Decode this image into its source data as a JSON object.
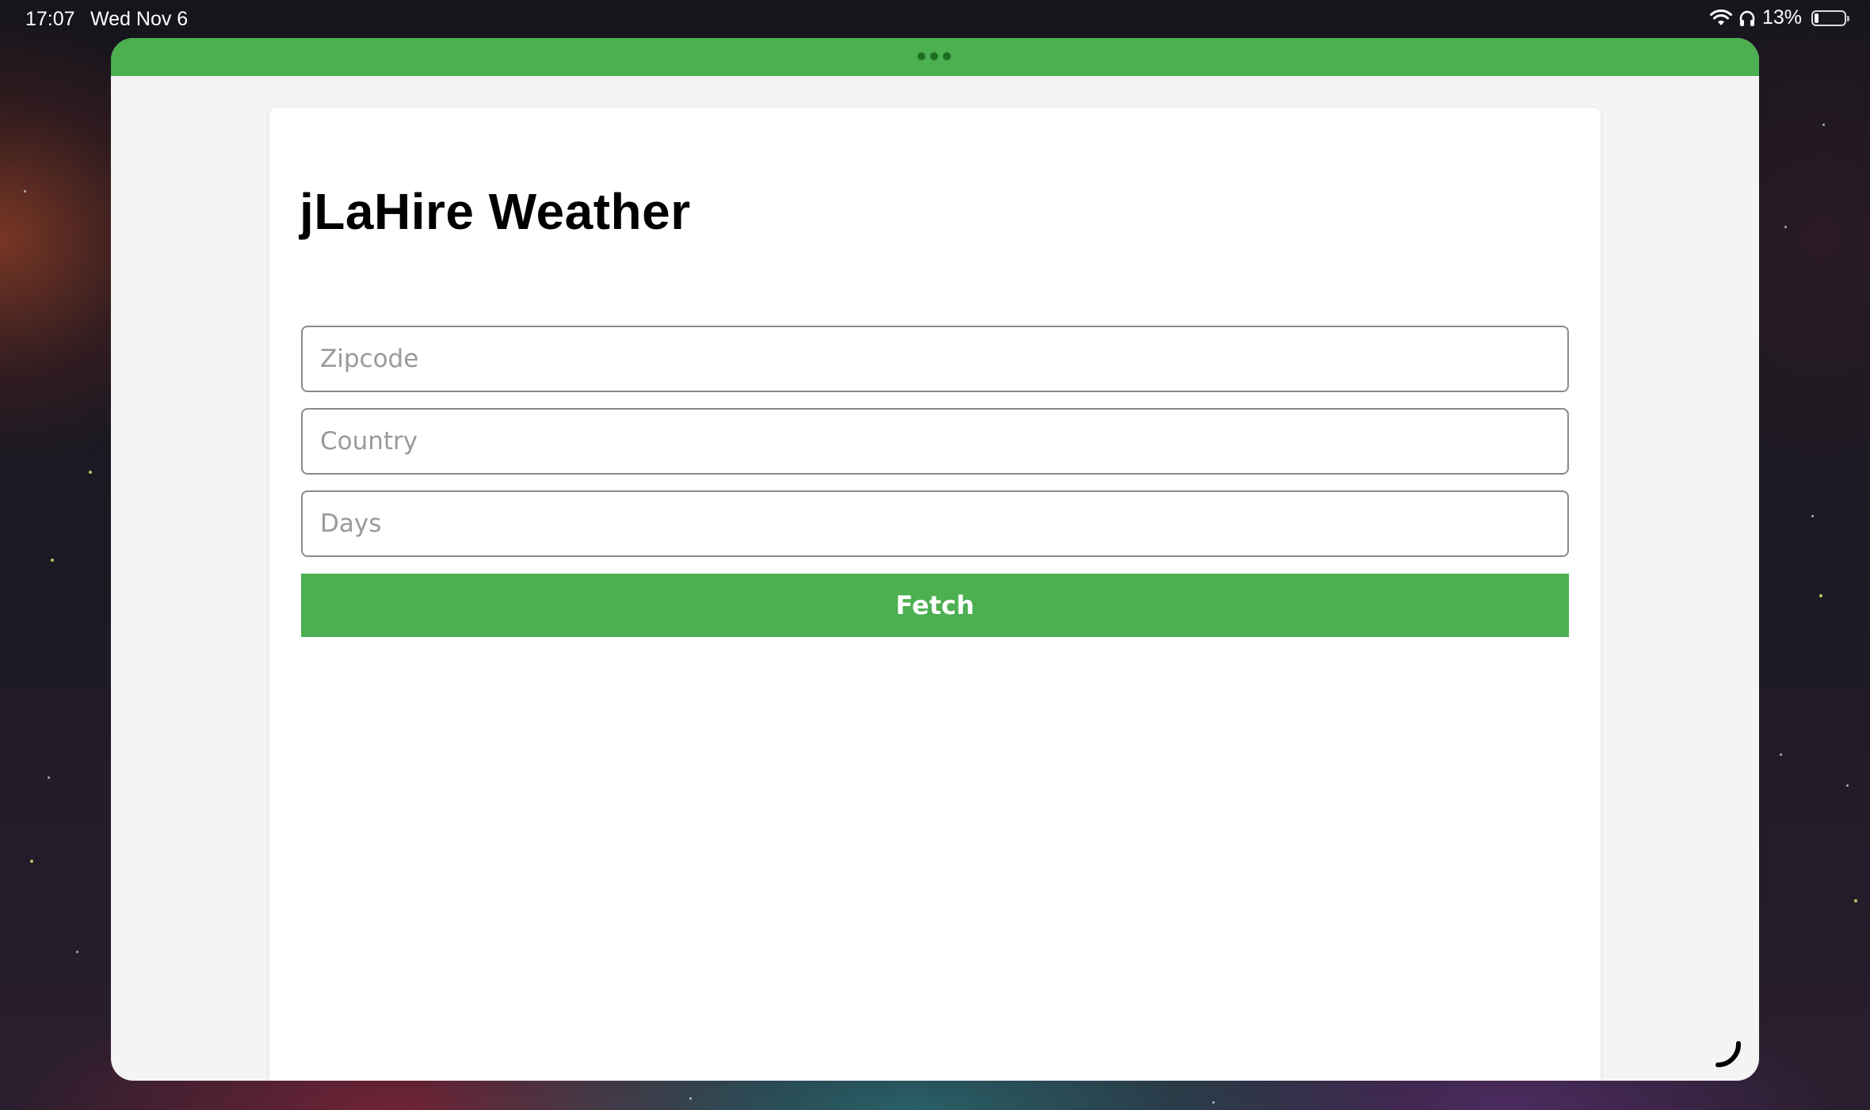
{
  "status_bar": {
    "time": "17:07",
    "date": "Wed Nov 6",
    "battery_percent": "13%",
    "battery_level": 0.13,
    "icons": [
      "wifi-icon",
      "headphones-icon",
      "battery-icon"
    ]
  },
  "window": {
    "accent_color": "#4caf50",
    "icons": [
      "multitask-dots-icon",
      "resize-handle-icon"
    ]
  },
  "app": {
    "title": "jLaHire Weather",
    "fields": {
      "zipcode": {
        "value": "",
        "placeholder": "Zipcode"
      },
      "country": {
        "value": "",
        "placeholder": "Country"
      },
      "days": {
        "value": "",
        "placeholder": "Days"
      }
    },
    "fetch_label": "Fetch"
  }
}
